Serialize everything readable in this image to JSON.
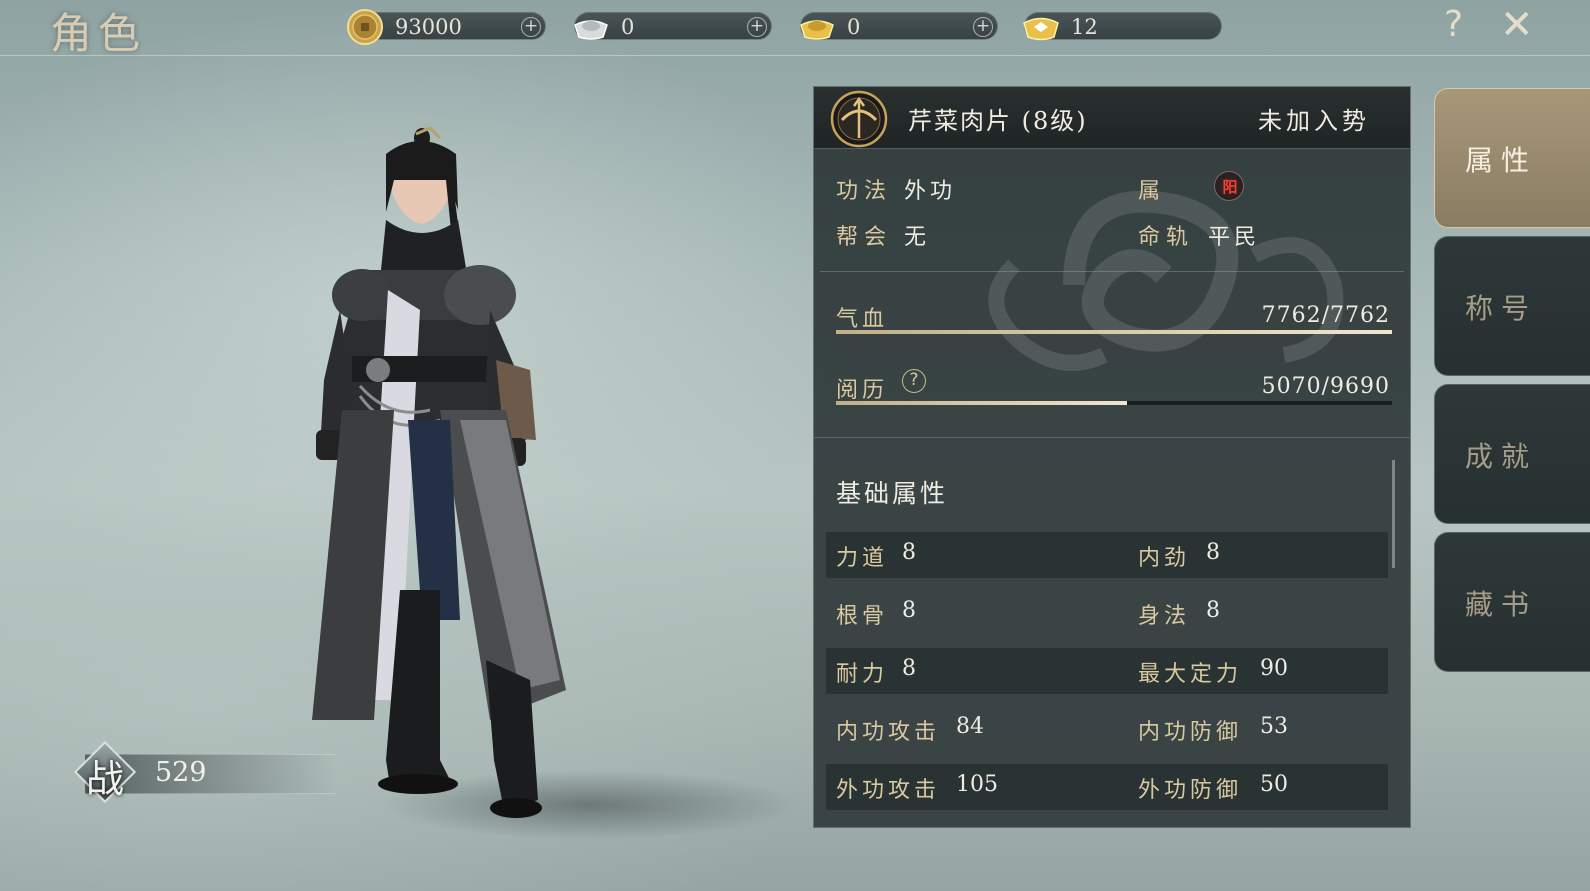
{
  "header": {
    "title": "角色"
  },
  "currencies": [
    {
      "icon": "copper-coin-icon",
      "value": "93000"
    },
    {
      "icon": "silver-ingot-icon",
      "value": "0"
    },
    {
      "icon": "gold-ingot-icon",
      "value": "0"
    },
    {
      "icon": "premium-ingot-icon",
      "value": "12"
    }
  ],
  "currency_add_label": "+",
  "help_label": "?",
  "close_label": "✕",
  "combat": {
    "glyph": "战",
    "value": "529"
  },
  "player": {
    "name": "芹菜肉片 (8级)",
    "faction": "未加入势"
  },
  "info": {
    "school_label": "功法",
    "school_value": "外功",
    "attr_label": "属",
    "attr_badge": "阳",
    "guild_label": "帮会",
    "guild_value": "无",
    "fate_label": "命轨",
    "fate_value": "平民"
  },
  "bars": {
    "hp": {
      "label": "气血",
      "value": "7762/7762",
      "fraction": 1.0
    },
    "exp": {
      "label": "阅历",
      "value": "5070/9690",
      "fraction": 0.5232
    }
  },
  "stats": {
    "section_title": "基础属性",
    "rows": [
      {
        "left_name": "力道",
        "left_value": "8",
        "right_name": "内劲",
        "right_value": "8"
      },
      {
        "left_name": "根骨",
        "left_value": "8",
        "right_name": "身法",
        "right_value": "8"
      },
      {
        "left_name": "耐力",
        "left_value": "8",
        "right_name": "最大定力",
        "right_value": "90"
      },
      {
        "left_name": "内功攻击",
        "left_value": "84",
        "right_name": "内功防御",
        "right_value": "53"
      },
      {
        "left_name": "外功攻击",
        "left_value": "105",
        "right_name": "外功防御",
        "right_value": "50"
      }
    ]
  },
  "tabs": [
    {
      "label": "属性",
      "active": true
    },
    {
      "label": "称号",
      "active": false
    },
    {
      "label": "成就",
      "active": false
    },
    {
      "label": "藏书",
      "active": false
    }
  ],
  "colors": {
    "accent_gold": "#d9c9a0",
    "panel_bg": "#2d3738",
    "attr_red": "#ff3b2f",
    "active_tab": "#a8987a"
  }
}
